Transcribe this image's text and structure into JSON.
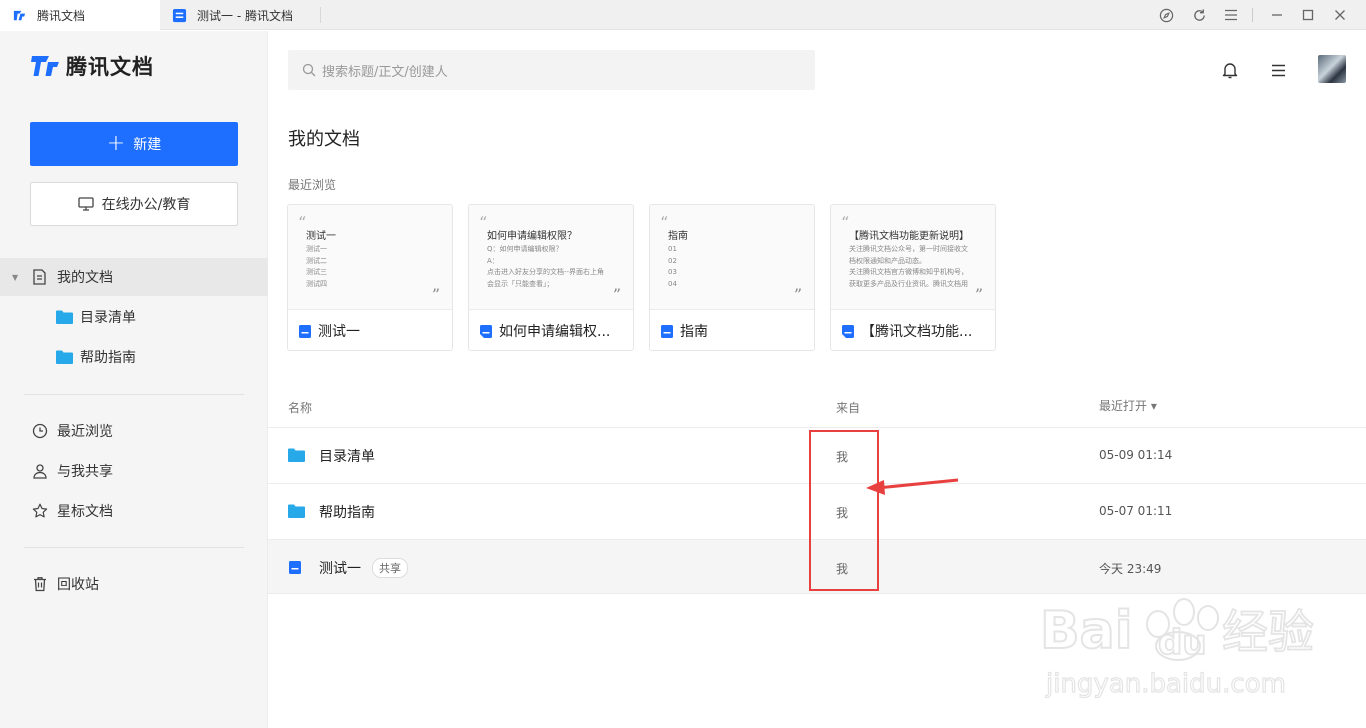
{
  "tabs": [
    {
      "label": "腾讯文档"
    },
    {
      "label": "测试一 - 腾讯文档"
    }
  ],
  "window_controls": [
    "compass-icon",
    "refresh-icon",
    "menu-icon",
    "minimize-icon",
    "maximize-icon",
    "close-icon"
  ],
  "sidebar": {
    "logo_text": "腾讯文档",
    "new_button": "新建",
    "office_button": "在线办公/教育",
    "nav": {
      "my_docs": "我的文档",
      "folder1": "目录清单",
      "folder2": "帮助指南",
      "recent": "最近浏览",
      "shared": "与我共享",
      "starred": "星标文档",
      "trash": "回收站"
    }
  },
  "search": {
    "placeholder": "搜索标题/正文/创建人"
  },
  "main": {
    "title": "我的文档",
    "recent_label": "最近浏览",
    "cards": [
      {
        "preview_title": "测试一",
        "preview_lines": [
          "测试一",
          "测试二",
          "测试三",
          "测试四"
        ],
        "name": "测试一"
      },
      {
        "preview_title": "如何申请编辑权限？",
        "preview_lines": [
          "Q：如何申请编辑权限？",
          "A：",
          "点击进入好友分享的文档--界面右上角",
          "会显示「只能查看」；"
        ],
        "name": "如何申请编辑权..."
      },
      {
        "preview_title": "指南",
        "preview_lines": [
          "01",
          "02",
          "03",
          "04"
        ],
        "name": "指南"
      },
      {
        "preview_title": "【腾讯文档功能更新说明】",
        "preview_lines": [
          "关注腾讯文档公众号，第一时间接收文",
          "档权限通知和产品动态。",
          "关注腾讯文档官方微博和知乎机构号，",
          "获取更多产品及行业资讯。腾讯文档用"
        ],
        "name": "【腾讯文档功能..."
      }
    ],
    "columns": {
      "name": "名称",
      "from": "来自",
      "opened": "最近打开 ▾"
    },
    "rows": [
      {
        "name": "目录清单",
        "from": "我",
        "time": "05-09 01:14",
        "type": "folder"
      },
      {
        "name": "帮助指南",
        "from": "我",
        "time": "05-07 01:11",
        "type": "folder"
      },
      {
        "name": "测试一",
        "from": "我",
        "time": "今天 23:49",
        "type": "doc",
        "tag": "共享"
      }
    ]
  },
  "colors": {
    "accent": "#1e6fff",
    "folder": "#27a8e8",
    "annotation": "#e8403f"
  },
  "watermark": {
    "brand": "Bai",
    "brand2": "du",
    "cn": "经验",
    "url": "jingyan.baidu.com"
  }
}
